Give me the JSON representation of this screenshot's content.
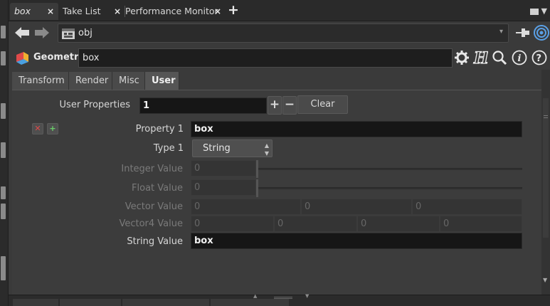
{
  "tabbar": {
    "tabs": [
      {
        "label": "box",
        "active": true
      },
      {
        "label": "Take List",
        "active": false
      },
      {
        "label": "Performance Monitor",
        "active": false
      }
    ],
    "close_glyph": "×",
    "add_glyph": "+"
  },
  "pathbar": {
    "path": "obj",
    "back_icon": "back-arrow-icon",
    "forward_icon": "forward-arrow-icon",
    "pin_icon": "pin-icon",
    "dropdown_glyph": "▾"
  },
  "node": {
    "type": "Geometry",
    "name": "box",
    "icon": "geometry-node-icon",
    "help_icons": [
      "gear-icon",
      "houdini-h-icon",
      "search-icon",
      "info-icon",
      "help-icon"
    ]
  },
  "param_tabs": [
    {
      "label": "Transform",
      "active": false
    },
    {
      "label": "Render",
      "active": false
    },
    {
      "label": "Misc",
      "active": false
    },
    {
      "label": "User",
      "active": true
    }
  ],
  "user": {
    "user_properties_label": "User Properties",
    "user_properties_value": "1",
    "plus_label": "+",
    "minus_label": "−",
    "clear_label": "Clear",
    "property_label": "Property 1",
    "property_value": "box",
    "type_label": "Type 1",
    "type_value": "String",
    "integer_label": "Integer Value",
    "integer_value": "0",
    "float_label": "Float Value",
    "float_value": "0",
    "vector_label": "Vector Value",
    "vector_values": [
      "0",
      "0",
      "0"
    ],
    "vector4_label": "Vector4 Value",
    "vector4_values": [
      "0",
      "0",
      "0",
      "0"
    ],
    "string_label": "String Value",
    "string_value": "box"
  },
  "colors": {
    "accent_blue": "#5aa0e6",
    "delete_red": "#e04a4a",
    "add_green": "#6bcf6b"
  }
}
